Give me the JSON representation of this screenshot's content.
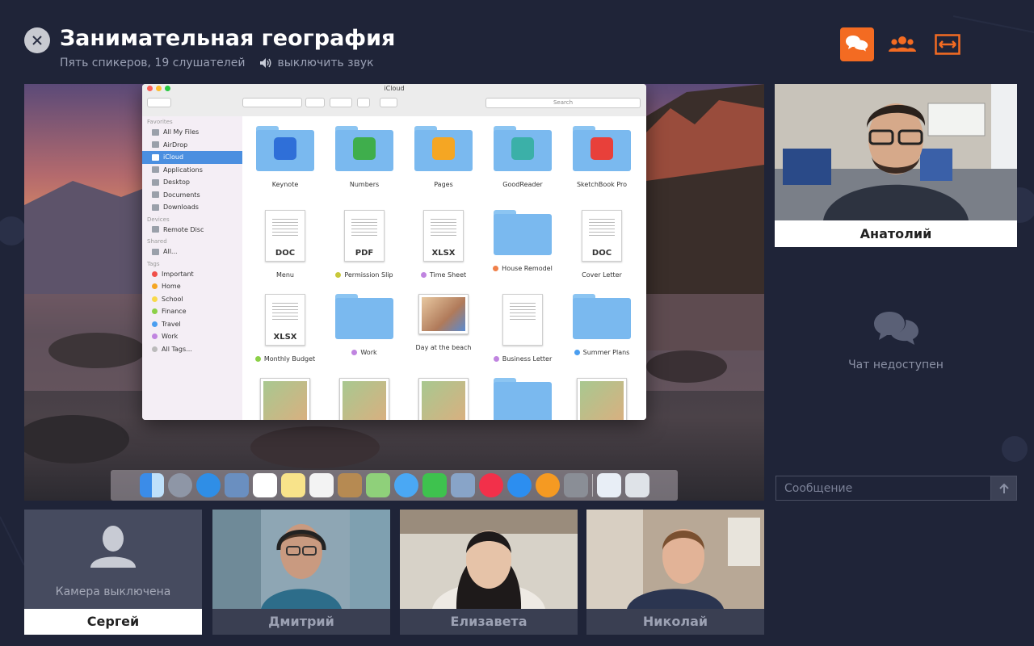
{
  "header": {
    "title": "Занимательная география",
    "subtitle": "Пять спикеров, 19 слушателей",
    "mute_label": "выключить звук"
  },
  "top_actions": [
    {
      "icon": "chat-icon",
      "active": true
    },
    {
      "icon": "users-icon",
      "active": false
    },
    {
      "icon": "expand-icon",
      "active": false
    }
  ],
  "shared_screen": {
    "window_title": "iCloud",
    "search_placeholder": "Search",
    "sidebar": {
      "favorites_header": "Favorites",
      "favorites": [
        "All My Files",
        "AirDrop",
        "iCloud",
        "Applications",
        "Desktop",
        "Documents",
        "Downloads"
      ],
      "devices_header": "Devices",
      "devices": [
        "Remote Disc"
      ],
      "shared_header": "Shared",
      "shared": [
        "All..."
      ],
      "tags_header": "Tags",
      "tags": [
        {
          "name": "Important",
          "color": "#f0504a"
        },
        {
          "name": "Home",
          "color": "#f5a623"
        },
        {
          "name": "School",
          "color": "#f8d94a"
        },
        {
          "name": "Finance",
          "color": "#8cd048"
        },
        {
          "name": "Travel",
          "color": "#4a9ef0"
        },
        {
          "name": "Work",
          "color": "#c084e0"
        },
        {
          "name": "All Tags...",
          "color": "#bbbbbb"
        }
      ]
    },
    "files": [
      {
        "name": "Keynote",
        "kind": "folder",
        "tag": ""
      },
      {
        "name": "Numbers",
        "kind": "folder",
        "tag": ""
      },
      {
        "name": "Pages",
        "kind": "folder",
        "tag": ""
      },
      {
        "name": "GoodReader",
        "kind": "folder",
        "tag": ""
      },
      {
        "name": "SketchBook Pro",
        "kind": "folder",
        "tag": ""
      },
      {
        "name": "Menu",
        "kind": "doc",
        "label": "DOC",
        "tag": ""
      },
      {
        "name": "Permission Slip",
        "kind": "doc",
        "label": "PDF",
        "tag": "#c8c83a"
      },
      {
        "name": "Time Sheet",
        "kind": "doc",
        "label": "XLSX",
        "tag": "#c084e0"
      },
      {
        "name": "House Remodel",
        "kind": "folder",
        "tag": "#f0804a"
      },
      {
        "name": "Cover Letter",
        "kind": "doc",
        "label": "DOC",
        "tag": ""
      },
      {
        "name": "Monthly Budget",
        "kind": "doc",
        "label": "XLSX",
        "tag": "#8cd048"
      },
      {
        "name": "Work",
        "kind": "folder",
        "tag": "#c084e0"
      },
      {
        "name": "Day at the beach",
        "kind": "photo",
        "tag": ""
      },
      {
        "name": "Business Letter",
        "kind": "doc",
        "label": "",
        "tag": "#c084e0"
      },
      {
        "name": "Summer Plans",
        "kind": "folder",
        "tag": "#4a9ef0"
      }
    ]
  },
  "speaker": {
    "name": "Анатолий"
  },
  "chat": {
    "unavailable": "Чат недоступен",
    "input_placeholder": "Сообщение"
  },
  "participants": [
    {
      "name": "Сергей",
      "camera_off": "Камера выключена"
    },
    {
      "name": "Дмитрий"
    },
    {
      "name": "Елизавета"
    },
    {
      "name": "Николай"
    }
  ]
}
